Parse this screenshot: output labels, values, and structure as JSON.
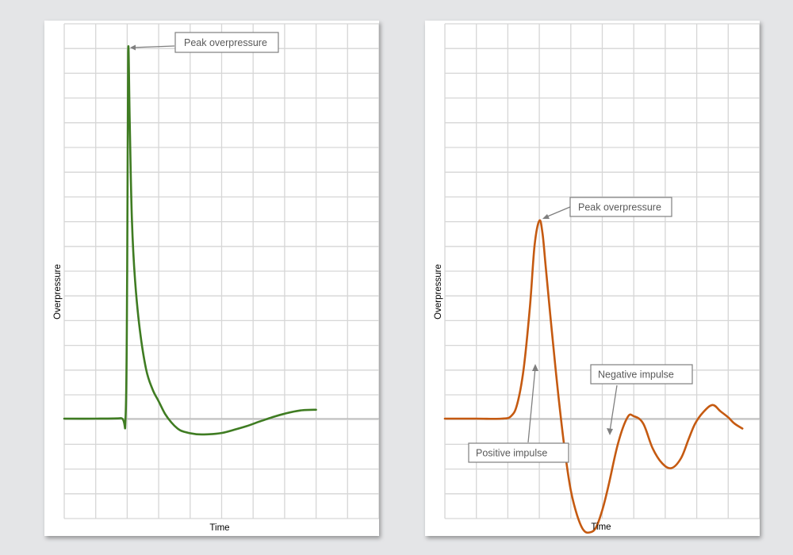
{
  "chart_data": [
    {
      "type": "line",
      "title": "",
      "xlabel": "Time",
      "ylabel": "Overpressure",
      "grid": true,
      "color": "#3f7c22",
      "annotations": [
        {
          "text": "Peak overpressure"
        }
      ],
      "series": [
        {
          "x": [
            0,
            1,
            1.8,
            1.95,
            2.0,
            2.03,
            2.08,
            2.15,
            2.25,
            2.4,
            2.6,
            2.8,
            3.0,
            3.2,
            3.4,
            3.6,
            3.8,
            4.2,
            4.6,
            5.0,
            5.4,
            5.8,
            6.2,
            6.6,
            7.0,
            7.5,
            8.0
          ],
          "y": [
            0,
            0,
            0.02,
            0.1,
            6.0,
            14.8,
            12.0,
            8.0,
            5.6,
            3.6,
            2.0,
            1.2,
            0.7,
            0.2,
            -0.15,
            -0.4,
            -0.53,
            -0.63,
            -0.63,
            -0.58,
            -0.45,
            -0.3,
            -0.12,
            0.05,
            0.2,
            0.33,
            0.36
          ]
        }
      ]
    },
    {
      "type": "line",
      "title": "",
      "xlabel": "Time",
      "ylabel": "Overpressure",
      "grid": true,
      "color": "#c55a11",
      "annotations": [
        {
          "text": "Peak overpressure"
        },
        {
          "text": "Negative impulse"
        },
        {
          "text": "Positive impulse"
        }
      ],
      "series": [
        {
          "x": [
            0,
            1.0,
            1.8,
            2.1,
            2.3,
            2.5,
            2.7,
            2.85,
            3.0,
            3.1,
            3.2,
            3.4,
            3.6,
            3.8,
            4.0,
            4.2,
            4.4,
            4.6,
            4.8,
            5.0,
            5.2,
            5.5,
            5.8,
            6.0,
            6.3,
            6.6,
            6.9,
            7.2,
            7.5,
            7.75,
            7.95,
            8.2,
            8.5,
            8.75,
            9.0,
            9.2,
            9.45
          ],
          "y": [
            0,
            0,
            0,
            0.1,
            0.6,
            2.0,
            4.5,
            7.0,
            8.0,
            7.5,
            6.2,
            3.5,
            1.0,
            -1.2,
            -2.9,
            -3.9,
            -4.5,
            -4.6,
            -4.4,
            -3.7,
            -2.7,
            -1.0,
            0.05,
            0.1,
            -0.2,
            -1.2,
            -1.8,
            -2.0,
            -1.6,
            -0.8,
            -0.2,
            0.25,
            0.55,
            0.3,
            0.05,
            -0.2,
            -0.4
          ]
        }
      ]
    }
  ]
}
